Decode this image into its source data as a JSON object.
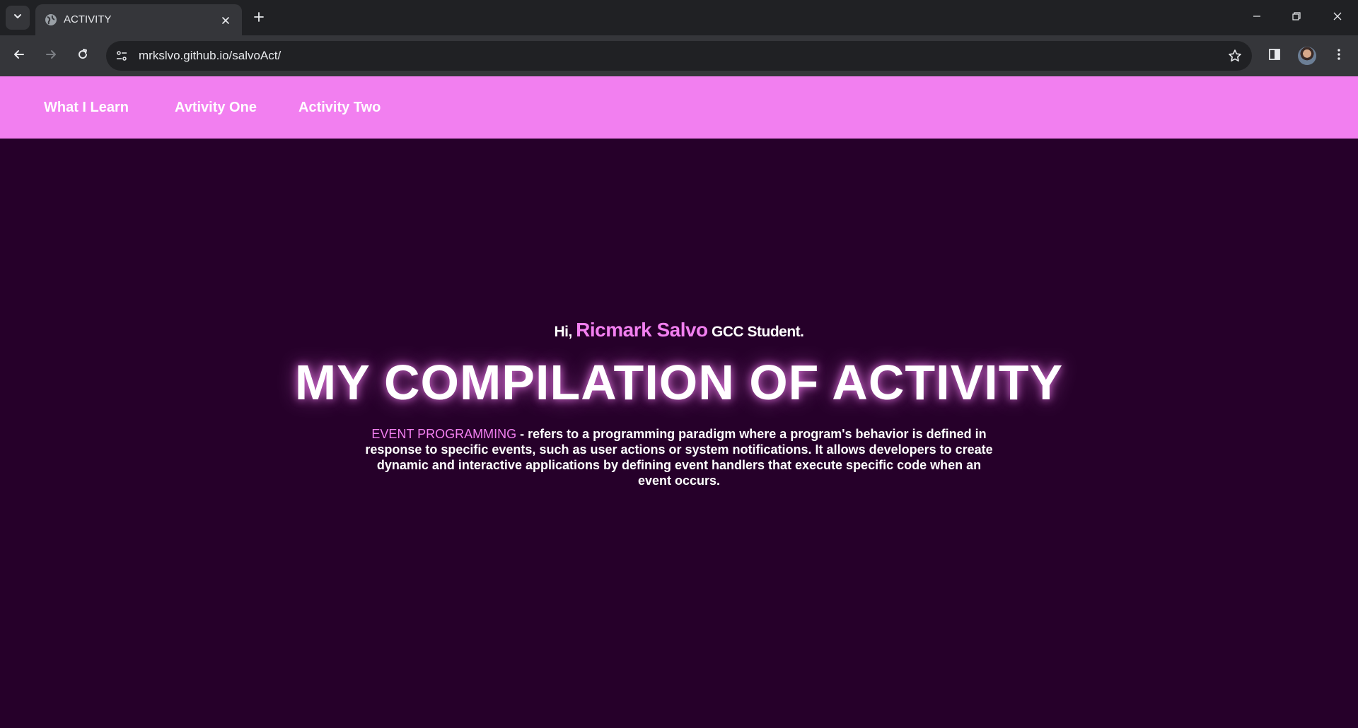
{
  "browser": {
    "tab_title": "ACTIVITY",
    "url": "mrkslvo.github.io/salvoAct/"
  },
  "nav": {
    "items": [
      {
        "label": "What I Learn"
      },
      {
        "label": "Avtivity One"
      },
      {
        "label": "Activity Two"
      }
    ]
  },
  "hero": {
    "greeting_prefix": "Hi,",
    "name": "Ricmark Salvo",
    "greeting_suffix": "GCC Student.",
    "title": "MY COMPILATION OF ACTIVITY",
    "term": "EVENT PROGRAMMING",
    "description": "- refers to a programming paradigm where a program's behavior is defined in response to specific events, such as user actions or system notifications. It allows developers to create dynamic and interactive applications by defining event handlers that execute specific code when an event occurs."
  },
  "colors": {
    "nav_background": "#f27ff0",
    "page_background": "#26002a",
    "accent": "#f27ff0",
    "text": "#ffffff"
  }
}
